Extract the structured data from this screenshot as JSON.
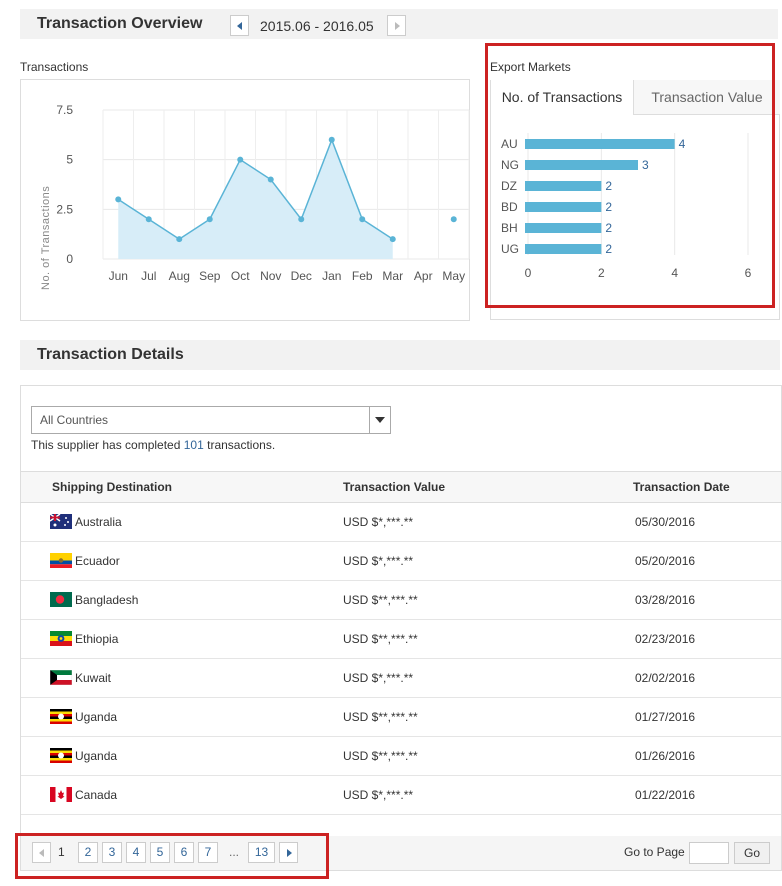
{
  "overview": {
    "title": "Transaction Overview",
    "period": "2015.06 - 2016.05"
  },
  "line_chart": {
    "caption": "Transactions"
  },
  "export_markets": {
    "caption": "Export Markets",
    "tabs": [
      "No. of Transactions",
      "Transaction Value"
    ],
    "active_tab": "No. of Transactions"
  },
  "chart_data": [
    {
      "type": "area",
      "title": "Transactions",
      "xlabel": "",
      "ylabel": "No. of Transactions",
      "categories": [
        "Jun",
        "Jul",
        "Aug",
        "Sep",
        "Oct",
        "Nov",
        "Dec",
        "Jan",
        "Feb",
        "Mar",
        "Apr",
        "May"
      ],
      "values": [
        3,
        2,
        1,
        2,
        5,
        4,
        2,
        6,
        2,
        1,
        null,
        2
      ],
      "y_ticks": [
        "0",
        "2.5",
        "5",
        "7.5"
      ],
      "ylim": [
        0,
        7.5
      ],
      "grid": true,
      "color": "#5ab4d6"
    },
    {
      "type": "bar",
      "orientation": "horizontal",
      "title": "Export Markets",
      "categories": [
        "AU",
        "NG",
        "DZ",
        "BD",
        "BH",
        "UG"
      ],
      "values": [
        4,
        3,
        2,
        2,
        2,
        2
      ],
      "x_ticks": [
        "0",
        "2",
        "4",
        "6"
      ],
      "xlim": [
        0,
        6
      ],
      "grid": true,
      "color": "#5ab4d6"
    }
  ],
  "details": {
    "title": "Transaction Details",
    "country_filter": "All Countries",
    "summary_prefix": "This supplier has completed ",
    "summary_count": "101",
    "summary_suffix": " transactions.",
    "columns": [
      "Shipping Destination",
      "Transaction Value",
      "Transaction Date"
    ],
    "rows": [
      {
        "country": "Australia",
        "flag": "australia-flag-icon",
        "value": "USD $*,***.**",
        "date": "05/30/2016"
      },
      {
        "country": "Ecuador",
        "flag": "ecuador-flag-icon",
        "value": "USD $*,***.**",
        "date": "05/20/2016"
      },
      {
        "country": "Bangladesh",
        "flag": "bangladesh-flag-icon",
        "value": "USD $**,***.**",
        "date": "03/28/2016"
      },
      {
        "country": "Ethiopia",
        "flag": "ethiopia-flag-icon",
        "value": "USD $**,***.**",
        "date": "02/23/2016"
      },
      {
        "country": "Kuwait",
        "flag": "kuwait-flag-icon",
        "value": "USD $*,***.**",
        "date": "02/02/2016"
      },
      {
        "country": "Uganda",
        "flag": "uganda-flag-icon",
        "value": "USD $**,***.**",
        "date": "01/27/2016"
      },
      {
        "country": "Uganda",
        "flag": "uganda-flag-icon",
        "value": "USD $**,***.**",
        "date": "01/26/2016"
      },
      {
        "country": "Canada",
        "flag": "canada-flag-icon",
        "value": "USD $*,***.**",
        "date": "01/22/2016"
      }
    ]
  },
  "pagination": {
    "current": "1",
    "pages": [
      "2",
      "3",
      "4",
      "5",
      "6",
      "7"
    ],
    "ellipsis": "...",
    "last": "13",
    "goto_label": "Go to Page",
    "goto_input": "",
    "goto_button": "Go"
  },
  "colors": {
    "accent": "#5ab4d6",
    "link": "#336699",
    "highlight": "#cc2222"
  }
}
